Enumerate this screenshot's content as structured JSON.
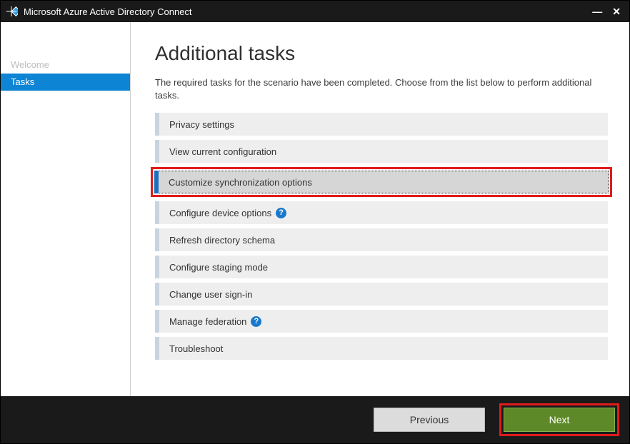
{
  "window": {
    "title": "Microsoft Azure Active Directory Connect"
  },
  "sidebar": {
    "items": [
      {
        "label": "Welcome",
        "active": false
      },
      {
        "label": "Tasks",
        "active": true
      }
    ]
  },
  "page": {
    "title": "Additional tasks",
    "description": "The required tasks for the scenario have been completed. Choose from the list below to perform additional tasks."
  },
  "tasks": [
    {
      "label": "Privacy settings",
      "selected": false,
      "help": false,
      "highlighted": false
    },
    {
      "label": "View current configuration",
      "selected": false,
      "help": false,
      "highlighted": false
    },
    {
      "label": "Customize synchronization options",
      "selected": true,
      "help": false,
      "highlighted": true
    },
    {
      "label": "Configure device options",
      "selected": false,
      "help": true,
      "highlighted": false
    },
    {
      "label": "Refresh directory schema",
      "selected": false,
      "help": false,
      "highlighted": false
    },
    {
      "label": "Configure staging mode",
      "selected": false,
      "help": false,
      "highlighted": false
    },
    {
      "label": "Change user sign-in",
      "selected": false,
      "help": false,
      "highlighted": false
    },
    {
      "label": "Manage federation",
      "selected": false,
      "help": true,
      "highlighted": false
    },
    {
      "label": "Troubleshoot",
      "selected": false,
      "help": false,
      "highlighted": false
    }
  ],
  "footer": {
    "previous": "Previous",
    "next": "Next"
  }
}
